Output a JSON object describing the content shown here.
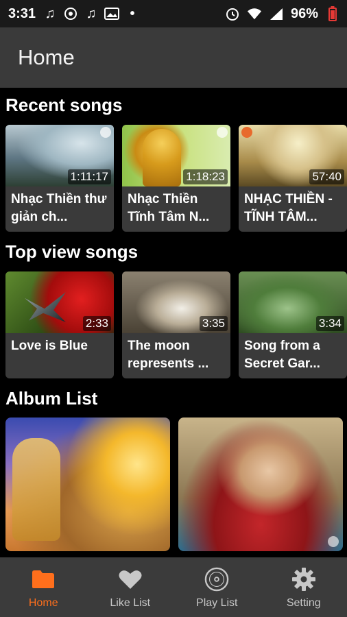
{
  "status_bar": {
    "time": "3:31",
    "battery": "96%"
  },
  "app_bar": {
    "title": "Home"
  },
  "sections": {
    "recent_title": "Recent songs",
    "top_view_title": "Top view songs",
    "album_title": "Album List"
  },
  "recent_songs": [
    {
      "title": "Nhạc Thiền thư giản ch...",
      "duration": "1:11:17"
    },
    {
      "title": "Nhạc Thiền Tĩnh Tâm N...",
      "duration": "1:18:23"
    },
    {
      "title": "NHẠC THIỀN - TĨNH TÂM...",
      "duration": "57:40"
    }
  ],
  "top_view_songs": [
    {
      "title": "Love is Blue",
      "duration": "2:33"
    },
    {
      "title": "The moon represents ...",
      "duration": "3:35"
    },
    {
      "title": "Song from a Secret Gar...",
      "duration": "3:34"
    }
  ],
  "bottom_nav": {
    "items": [
      {
        "label": "Home",
        "icon": "folder-icon",
        "active": true
      },
      {
        "label": "Like List",
        "icon": "heart-icon",
        "active": false
      },
      {
        "label": "Play List",
        "icon": "disc-icon",
        "active": false
      },
      {
        "label": "Setting",
        "icon": "gear-icon",
        "active": false
      }
    ]
  },
  "colors": {
    "accent": "#ff6f1c",
    "app_bar": "#3a3a3a",
    "card": "#3a3a3a",
    "background": "#000000"
  }
}
